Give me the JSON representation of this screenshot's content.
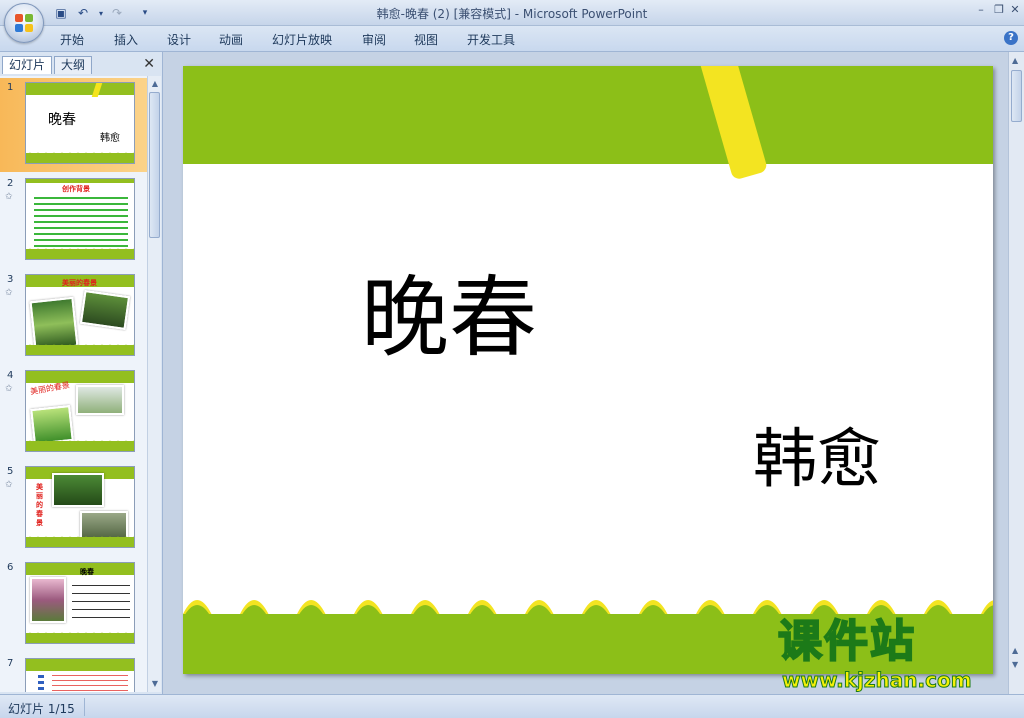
{
  "window": {
    "title": "韩愈-晚春 (2) [兼容模式] - Microsoft PowerPoint"
  },
  "ribbon": {
    "tabs": [
      "开始",
      "插入",
      "设计",
      "动画",
      "幻灯片放映",
      "审阅",
      "视图",
      "开发工具"
    ]
  },
  "pane": {
    "tab_slides": "幻灯片",
    "tab_outline": "大纲",
    "thumbnails": [
      {
        "num": "1",
        "title": "晚春",
        "subtitle": "韩愈"
      },
      {
        "num": "2",
        "title": "创作背景"
      },
      {
        "num": "3",
        "title": "美丽的春景"
      },
      {
        "num": "4",
        "title": "美丽的春景"
      },
      {
        "num": "5",
        "title": "美丽的春景"
      },
      {
        "num": "6",
        "title": "晚春"
      },
      {
        "num": "7",
        "title": ""
      }
    ]
  },
  "slide": {
    "title": "晚春",
    "subtitle": "韩愈"
  },
  "watermark": {
    "brand": "课件站",
    "url": "www.kjzhan.com"
  },
  "status": {
    "slide_indicator": "幻灯片 1/15"
  },
  "colors": {
    "slide_green": "#8cbf18",
    "slide_yellow": "#f3e421",
    "selection_orange": "#f8b858"
  }
}
